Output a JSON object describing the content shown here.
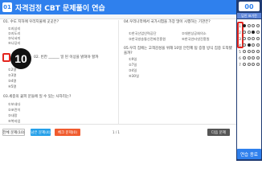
{
  "header": {
    "logo_text": "01",
    "title": "자격검정 CBT 문제풀이 연습"
  },
  "right_panel": {
    "timer": "00",
    "sheet_title": "답안 표기란",
    "answer_rows": [
      {
        "num": "1",
        "filled": 0
      },
      {
        "num": "2",
        "filled": 2
      },
      {
        "num": "3",
        "filled": -1
      },
      {
        "num": "4",
        "filled": 1
      },
      {
        "num": "5",
        "filled": -1
      },
      {
        "num": "6",
        "filled": -1
      },
      {
        "num": "7",
        "filled": -1
      }
    ],
    "submit_label": "연습 종료"
  },
  "questions": {
    "q1": {
      "title": "01. 수도 지하에 우리지물에 곳곳은?",
      "choices": [
        "①지상리",
        "②지도리",
        "③낙서미",
        "④나당리"
      ]
    },
    "q2": {
      "title": "02. 빈칸 ______ 일 된 이상을 밝혀야 할까",
      "choices": [
        "①2명",
        "②3명",
        "③4명",
        "④5명"
      ]
    },
    "q3": {
      "title": "03.세종의 꽃피 문들에 일 수 있는 사자리는?",
      "choices": [
        "①보내다",
        "②포란이",
        "③내망",
        "④복자업"
      ]
    },
    "q4": {
      "title": "04.우리나라에서 국가시험을 가장 많이 시행하는 기관은?",
      "choices": [
        "①한국산업인력공단",
        "②대한상공회의소",
        "③한국방송통신전파진흥원",
        "④한국인터넷진흥원"
      ]
    },
    "q5": {
      "title": "05.우리 집에는 고객감성을 위해 10일 안전제 탐 증정 방식 집중 도착됐을까?",
      "choices": [
        "①9일",
        "②7일",
        "③4일",
        "④30일"
      ]
    }
  },
  "overlay": {
    "big_number": "10"
  },
  "bottom": {
    "all_label": "전체 문제(10)",
    "unsolved_label": "남은 문제(4)",
    "saved_label": "체크 문제(0)",
    "page": "1 / 1",
    "next_label": "다음 문제"
  }
}
